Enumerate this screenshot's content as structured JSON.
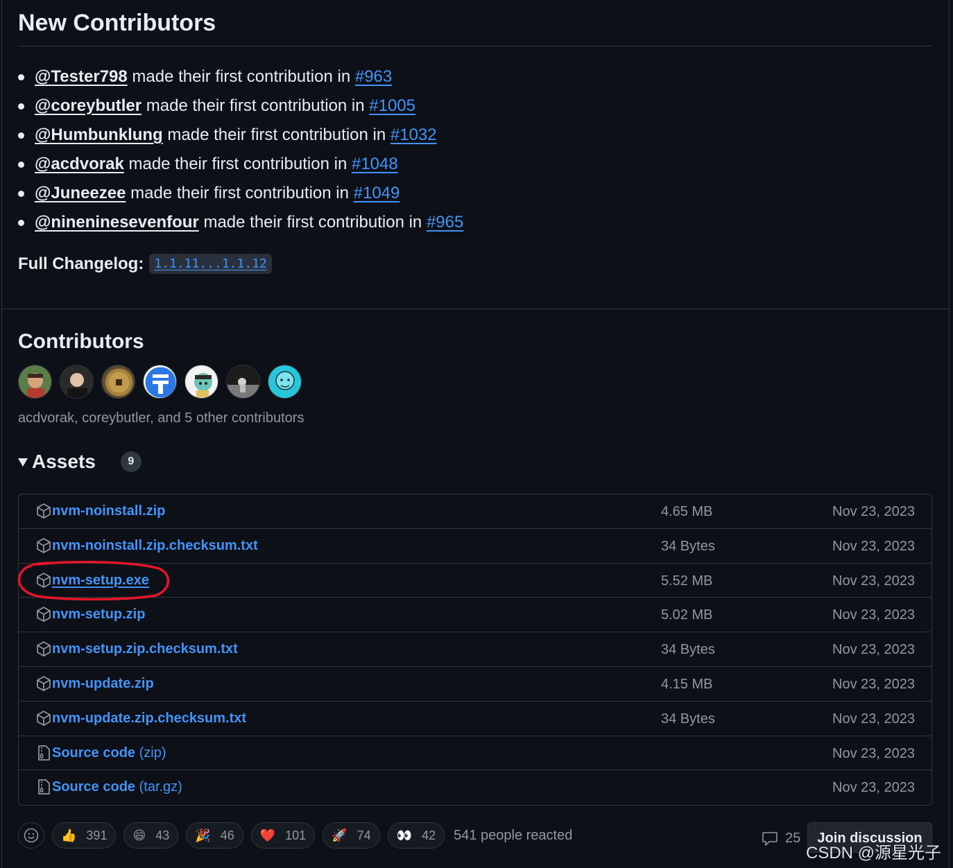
{
  "new_contributors": {
    "title": "New Contributors",
    "items": [
      {
        "user": "@Tester798",
        "text": " made their first contribution in ",
        "pr": "#963"
      },
      {
        "user": "@coreybutler",
        "text": " made their first contribution in ",
        "pr": "#1005"
      },
      {
        "user": "@Humbunklung",
        "text": " made their first contribution in ",
        "pr": "#1032"
      },
      {
        "user": "@acdvorak",
        "text": " made their first contribution in ",
        "pr": "#1048"
      },
      {
        "user": "@Juneezee",
        "text": " made their first contribution in ",
        "pr": "#1049"
      },
      {
        "user": "@nineninesevenfour",
        "text": " made their first contribution in ",
        "pr": "#965"
      }
    ],
    "changelog_label": "Full Changelog",
    "changelog_link": "1.1.11...1.1.12"
  },
  "contributors": {
    "title": "Contributors",
    "summary": "acdvorak, coreybutler, and 5 other contributors"
  },
  "assets": {
    "title": "Assets",
    "count": "9",
    "rows": [
      {
        "icon": "package-icon",
        "name": "nvm-noinstall.zip",
        "sub": "",
        "size": "4.65 MB",
        "date": "Nov 23, 2023"
      },
      {
        "icon": "package-icon",
        "name": "nvm-noinstall.zip.checksum.txt",
        "sub": "",
        "size": "34 Bytes",
        "date": "Nov 23, 2023"
      },
      {
        "icon": "package-icon",
        "name": "nvm-setup.exe",
        "sub": "",
        "size": "5.52 MB",
        "date": "Nov 23, 2023"
      },
      {
        "icon": "package-icon",
        "name": "nvm-setup.zip",
        "sub": "",
        "size": "5.02 MB",
        "date": "Nov 23, 2023"
      },
      {
        "icon": "package-icon",
        "name": "nvm-setup.zip.checksum.txt",
        "sub": "",
        "size": "34 Bytes",
        "date": "Nov 23, 2023"
      },
      {
        "icon": "package-icon",
        "name": "nvm-update.zip",
        "sub": "",
        "size": "4.15 MB",
        "date": "Nov 23, 2023"
      },
      {
        "icon": "package-icon",
        "name": "nvm-update.zip.checksum.txt",
        "sub": "",
        "size": "34 Bytes",
        "date": "Nov 23, 2023"
      },
      {
        "icon": "file-zip-icon",
        "name": "Source code",
        "sub": " (zip)",
        "size": "",
        "date": "Nov 23, 2023"
      },
      {
        "icon": "file-zip-icon",
        "name": "Source code",
        "sub": " (tar.gz)",
        "size": "",
        "date": "Nov 23, 2023"
      }
    ]
  },
  "reactions": {
    "items": [
      {
        "emoji": "👍",
        "count": "391"
      },
      {
        "emoji": "😄",
        "count": "43"
      },
      {
        "emoji": "🎉",
        "count": "46"
      },
      {
        "emoji": "❤️",
        "count": "101"
      },
      {
        "emoji": "🚀",
        "count": "74"
      },
      {
        "emoji": "👀",
        "count": "42"
      }
    ],
    "summary": "541 people reacted"
  },
  "discussion": {
    "comment_count": "25",
    "join_label": "Join discussion"
  },
  "watermark": "CSDN @源星光子",
  "colors": {
    "background": "#0d1117",
    "link": "#4493f8",
    "muted": "#9198a1",
    "border": "#30363d",
    "annotation_circle": "#e5152a"
  }
}
